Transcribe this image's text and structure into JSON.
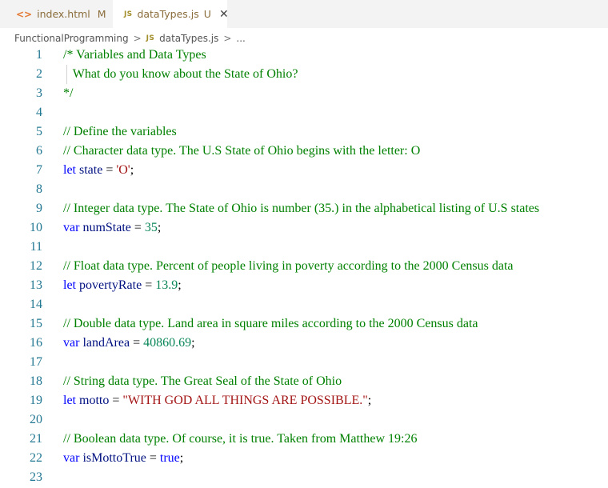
{
  "tabs": [
    {
      "icon": "<>",
      "label": "index.html",
      "status": "M"
    },
    {
      "icon": "JS",
      "label": "dataTypes.js",
      "status": "U",
      "close": "✕"
    }
  ],
  "breadcrumb": {
    "folder": "FunctionalProgramming",
    "sep1": ">",
    "file_icon": "JS",
    "file": "dataTypes.js",
    "sep2": ">",
    "more": "..."
  },
  "lines": [
    {
      "n": "1",
      "tokens": [
        {
          "t": "/* Variables and Data Types",
          "c": "comment"
        }
      ]
    },
    {
      "n": "2",
      "tokens": [
        {
          "t": "   What do you know about the State of Ohio?",
          "c": "comment"
        }
      ]
    },
    {
      "n": "3",
      "tokens": [
        {
          "t": "*/",
          "c": "comment"
        }
      ]
    },
    {
      "n": "4",
      "tokens": []
    },
    {
      "n": "5",
      "tokens": [
        {
          "t": "// Define the variables",
          "c": "comment"
        }
      ]
    },
    {
      "n": "6",
      "tokens": [
        {
          "t": "// Character data type. The U.S State of Ohio begins with the letter: O",
          "c": "comment"
        }
      ]
    },
    {
      "n": "7",
      "tokens": [
        {
          "t": "let",
          "c": "kw"
        },
        {
          "t": " ",
          "c": "punc"
        },
        {
          "t": "state",
          "c": "ident"
        },
        {
          "t": " = ",
          "c": "punc"
        },
        {
          "t": "'O'",
          "c": "str"
        },
        {
          "t": ";",
          "c": "punc"
        }
      ]
    },
    {
      "n": "8",
      "tokens": []
    },
    {
      "n": "9",
      "tokens": [
        {
          "t": "// Integer data type. The State of Ohio is number (35.) in the alphabetical listing of U.S states",
          "c": "comment"
        }
      ]
    },
    {
      "n": "10",
      "tokens": [
        {
          "t": "var",
          "c": "kw"
        },
        {
          "t": " ",
          "c": "punc"
        },
        {
          "t": "numState",
          "c": "ident"
        },
        {
          "t": " = ",
          "c": "punc"
        },
        {
          "t": "35",
          "c": "num"
        },
        {
          "t": ";",
          "c": "punc"
        }
      ]
    },
    {
      "n": "11",
      "tokens": []
    },
    {
      "n": "12",
      "tokens": [
        {
          "t": "// Float data type. Percent of people living in poverty according to the 2000 Census data",
          "c": "comment"
        }
      ]
    },
    {
      "n": "13",
      "tokens": [
        {
          "t": "let",
          "c": "kw"
        },
        {
          "t": " ",
          "c": "punc"
        },
        {
          "t": "povertyRate",
          "c": "ident"
        },
        {
          "t": " = ",
          "c": "punc"
        },
        {
          "t": "13.9",
          "c": "num"
        },
        {
          "t": ";",
          "c": "punc"
        }
      ]
    },
    {
      "n": "14",
      "tokens": []
    },
    {
      "n": "15",
      "tokens": [
        {
          "t": "// Double data type. Land area in square miles according to the 2000 Census data",
          "c": "comment"
        }
      ]
    },
    {
      "n": "16",
      "tokens": [
        {
          "t": "var",
          "c": "kw"
        },
        {
          "t": " ",
          "c": "punc"
        },
        {
          "t": "landArea",
          "c": "ident"
        },
        {
          "t": " = ",
          "c": "punc"
        },
        {
          "t": "40860.69",
          "c": "num"
        },
        {
          "t": ";",
          "c": "punc"
        }
      ]
    },
    {
      "n": "17",
      "tokens": []
    },
    {
      "n": "18",
      "tokens": [
        {
          "t": "// String data type. The Great Seal of the State of Ohio",
          "c": "comment"
        }
      ]
    },
    {
      "n": "19",
      "tokens": [
        {
          "t": "let",
          "c": "kw"
        },
        {
          "t": " ",
          "c": "punc"
        },
        {
          "t": "motto",
          "c": "ident"
        },
        {
          "t": " = ",
          "c": "punc"
        },
        {
          "t": "\"WITH GOD ALL THINGS ARE POSSIBLE.\"",
          "c": "str"
        },
        {
          "t": ";",
          "c": "punc"
        }
      ]
    },
    {
      "n": "20",
      "tokens": []
    },
    {
      "n": "21",
      "tokens": [
        {
          "t": "// Boolean data type. Of course, it is true. Taken from Matthew 19:26",
          "c": "comment"
        }
      ]
    },
    {
      "n": "22",
      "tokens": [
        {
          "t": "var",
          "c": "kw"
        },
        {
          "t": " ",
          "c": "punc"
        },
        {
          "t": "isMottoTrue",
          "c": "ident"
        },
        {
          "t": " = ",
          "c": "punc"
        },
        {
          "t": "true",
          "c": "kw"
        },
        {
          "t": ";",
          "c": "punc"
        }
      ]
    },
    {
      "n": "23",
      "tokens": []
    }
  ],
  "colors": {
    "comment": "#008000",
    "keyword": "#0000ff",
    "identifier": "#001080",
    "number": "#098658",
    "string": "#a31515",
    "line_number": "#237893",
    "modified_tab": "#8a6d3b"
  }
}
